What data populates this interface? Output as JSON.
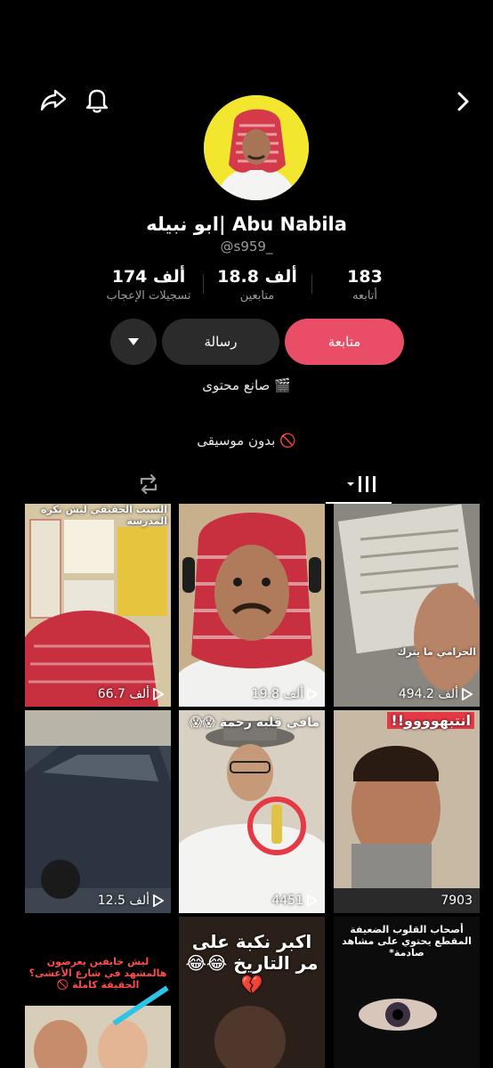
{
  "profile": {
    "name": "ابو نبيله| Abu Nabila",
    "username": "@s959_",
    "bio_line1": "صانع محتوى 🎬",
    "bio_line2": "بدون موسيقى 🚫"
  },
  "stats": {
    "following": {
      "value": "183",
      "label": "أتابعه"
    },
    "followers": {
      "value": "18.8 ألف",
      "label": "متابعين"
    },
    "likes": {
      "value": "174 ألف",
      "label": "تسجيلات الإعجاب"
    }
  },
  "actions": {
    "follow_label": "متابعة",
    "message_label": "رسالة"
  },
  "icons": {
    "share": "share-icon",
    "bell": "bell-icon",
    "back": "chevron-right-icon",
    "dropdown": "caret-down-icon",
    "repost": "repost-icon",
    "videos": "grid-videos-icon",
    "play": "play-icon"
  },
  "colors": {
    "accent": "#ea4d66",
    "avatar_bg": "#f2e72e"
  },
  "videos": [
    {
      "views": "66.7 ألف",
      "caption": "السبب الحقيقي ليش نكره المدرسة"
    },
    {
      "views": "19.8 ألف",
      "caption": ""
    },
    {
      "views": "494.2 ألف",
      "caption": "الحرامي ما يترك"
    },
    {
      "views": "12.5 ألف",
      "caption": ""
    },
    {
      "views": "4451",
      "caption": "مافي قلبه رحمة 😱😱"
    },
    {
      "views": "7903",
      "caption": "انتبهوووو!!"
    },
    {
      "views": "",
      "caption": "ليش خايفين يعرضون هالمشهد في شارع الأعشى؟ الحقيقة كاملة 🚫"
    },
    {
      "views": "",
      "caption": "اكبر نكبة على مر التاريخ 😂😂💔"
    },
    {
      "views": "",
      "caption": "أصحاب القلوب الضعيفة المقطع يحتوي على مشاهد صادمة*"
    }
  ]
}
